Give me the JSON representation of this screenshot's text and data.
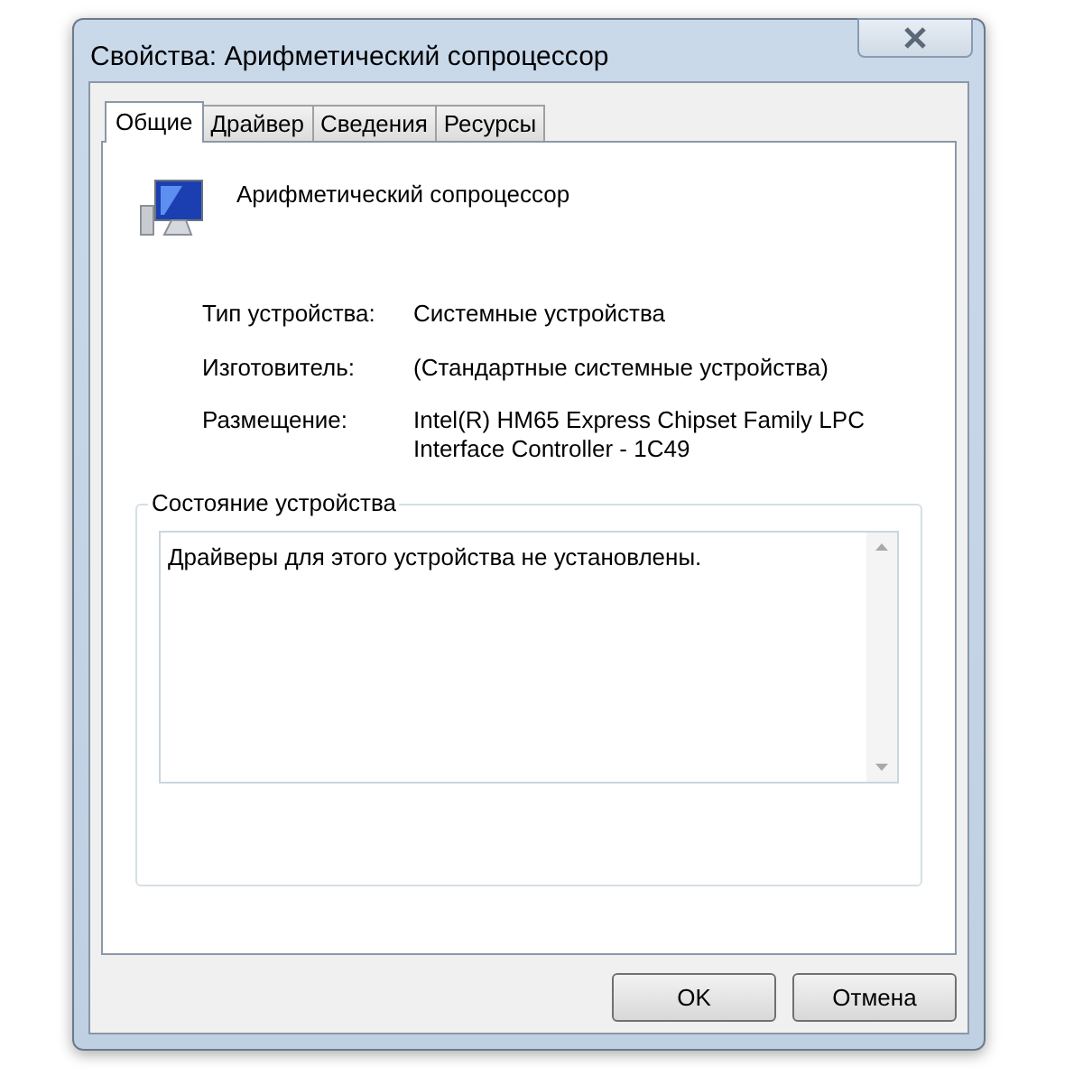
{
  "window": {
    "title": "Свойства: Арифметический сопроцессор"
  },
  "tabs": [
    {
      "label": "Общие",
      "selected": true
    },
    {
      "label": "Драйвер",
      "selected": false
    },
    {
      "label": "Сведения",
      "selected": false
    },
    {
      "label": "Ресурсы",
      "selected": false
    }
  ],
  "device": {
    "name": "Арифметический сопроцессор"
  },
  "properties": [
    {
      "label": "Тип устройства:",
      "value": "Системные устройства"
    },
    {
      "label": "Изготовитель:",
      "value": "(Стандартные системные устройства)"
    },
    {
      "label": "Размещение:",
      "value": "Intel(R) HM65 Express Chipset Family LPC Interface Controller - 1C49"
    }
  ],
  "status": {
    "title": "Состояние устройства",
    "text": "Драйверы для этого устройства не установлены."
  },
  "buttons": [
    "OK",
    "Отмена"
  ]
}
